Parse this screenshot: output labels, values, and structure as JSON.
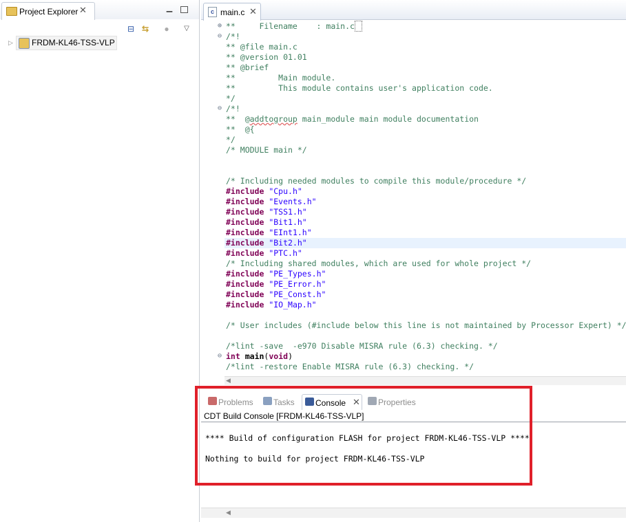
{
  "project_explorer": {
    "tab_label": "Project Explorer",
    "project_name": "FRDM-KL46-TSS-VLP",
    "icons": [
      "folder-icon",
      "close-icon",
      "minimize-icon",
      "maximize-icon",
      "collapse-all-icon",
      "link-with-editor-icon",
      "filter-icon",
      "view-menu-icon",
      "project-icon",
      "expand-arrow-icon"
    ]
  },
  "editor": {
    "tab_label": "main.c",
    "lines": [
      {
        "fold": "⊕",
        "segs": [
          {
            "t": "**     Filename    : main.c",
            "c": "cm"
          },
          {
            "t": " ",
            "c": "caret"
          }
        ]
      },
      {
        "fold": "⊖",
        "segs": [
          {
            "t": "/*!",
            "c": "cm"
          }
        ]
      },
      {
        "segs": [
          {
            "t": "** @file main.c",
            "c": "cm"
          }
        ]
      },
      {
        "segs": [
          {
            "t": "** @version 01.01",
            "c": "cm"
          }
        ]
      },
      {
        "segs": [
          {
            "t": "** @brief",
            "c": "cm"
          }
        ]
      },
      {
        "segs": [
          {
            "t": "**         Main module.",
            "c": "cm"
          }
        ]
      },
      {
        "segs": [
          {
            "t": "**         This module contains user's application code.",
            "c": "cm"
          }
        ]
      },
      {
        "segs": [
          {
            "t": "*/",
            "c": "cm"
          }
        ]
      },
      {
        "fold": "⊖",
        "segs": [
          {
            "t": "/*!",
            "c": "cm"
          }
        ]
      },
      {
        "segs": [
          {
            "t": "**  @",
            "c": "cm"
          },
          {
            "t": "addtogroup",
            "c": "ul"
          },
          {
            "t": " main_module main module documentation",
            "c": "cm"
          }
        ]
      },
      {
        "segs": [
          {
            "t": "**  @{",
            "c": "cm"
          }
        ]
      },
      {
        "segs": [
          {
            "t": "*/",
            "c": "cm"
          }
        ]
      },
      {
        "segs": [
          {
            "t": "/* MODULE main */",
            "c": "cm"
          }
        ]
      },
      {
        "segs": []
      },
      {
        "segs": []
      },
      {
        "segs": [
          {
            "t": "/* Including needed modules to compile this module/procedure */",
            "c": "cm"
          }
        ]
      },
      {
        "segs": [
          {
            "t": "#include",
            "c": "kw"
          },
          {
            "t": " ",
            "c": "cm"
          },
          {
            "t": "\"Cpu.h\"",
            "c": "str"
          }
        ]
      },
      {
        "segs": [
          {
            "t": "#include",
            "c": "kw"
          },
          {
            "t": " ",
            "c": "cm"
          },
          {
            "t": "\"Events.h\"",
            "c": "str"
          }
        ]
      },
      {
        "segs": [
          {
            "t": "#include",
            "c": "kw"
          },
          {
            "t": " ",
            "c": "cm"
          },
          {
            "t": "\"TSS1.h\"",
            "c": "str"
          }
        ]
      },
      {
        "segs": [
          {
            "t": "#include",
            "c": "kw"
          },
          {
            "t": " ",
            "c": "cm"
          },
          {
            "t": "\"Bit1.h\"",
            "c": "str"
          }
        ]
      },
      {
        "segs": [
          {
            "t": "#include",
            "c": "kw"
          },
          {
            "t": " ",
            "c": "cm"
          },
          {
            "t": "\"EInt1.h\"",
            "c": "str"
          }
        ]
      },
      {
        "hl": true,
        "segs": [
          {
            "t": "#include",
            "c": "kw"
          },
          {
            "t": " ",
            "c": "cm"
          },
          {
            "t": "\"Bit2.h\"",
            "c": "str"
          }
        ]
      },
      {
        "segs": [
          {
            "t": "#include",
            "c": "kw"
          },
          {
            "t": " ",
            "c": "cm"
          },
          {
            "t": "\"PTC.h\"",
            "c": "str"
          }
        ]
      },
      {
        "segs": [
          {
            "t": "/* Including shared modules, which are used for whole project */",
            "c": "cm"
          }
        ]
      },
      {
        "segs": [
          {
            "t": "#include",
            "c": "kw"
          },
          {
            "t": " ",
            "c": "cm"
          },
          {
            "t": "\"PE_Types.h\"",
            "c": "str"
          }
        ]
      },
      {
        "segs": [
          {
            "t": "#include",
            "c": "kw"
          },
          {
            "t": " ",
            "c": "cm"
          },
          {
            "t": "\"PE_Error.h\"",
            "c": "str"
          }
        ]
      },
      {
        "segs": [
          {
            "t": "#include",
            "c": "kw"
          },
          {
            "t": " ",
            "c": "cm"
          },
          {
            "t": "\"PE_Const.h\"",
            "c": "str"
          }
        ]
      },
      {
        "segs": [
          {
            "t": "#include",
            "c": "kw"
          },
          {
            "t": " ",
            "c": "cm"
          },
          {
            "t": "\"IO_Map.h\"",
            "c": "str"
          }
        ]
      },
      {
        "segs": []
      },
      {
        "segs": [
          {
            "t": "/* User includes (#include below this line is not maintained by Processor Expert) */",
            "c": "cm"
          }
        ]
      },
      {
        "segs": []
      },
      {
        "segs": [
          {
            "t": "/*lint -save  -e970 Disable MISRA rule (6.3) checking. */",
            "c": "cm"
          }
        ]
      },
      {
        "fold": "⊖",
        "segs": [
          {
            "t": "int",
            "c": "kw"
          },
          {
            "t": " ",
            "c": "cm"
          },
          {
            "t": "main",
            "c": "fn"
          },
          {
            "t": "(",
            "c": "pl"
          },
          {
            "t": "void",
            "c": "kw"
          },
          {
            "t": ")",
            "c": "pl"
          }
        ]
      },
      {
        "segs": [
          {
            "t": "/*lint -restore Enable MISRA rule (6.3) checking. */",
            "c": "cm"
          }
        ]
      }
    ]
  },
  "console": {
    "tabs": [
      {
        "label": "Problems",
        "icon": "problems-icon",
        "color": "#c96a6a"
      },
      {
        "label": "Tasks",
        "icon": "tasks-icon",
        "color": "#8aa0c0"
      },
      {
        "label": "Console",
        "icon": "console-icon",
        "color": "#3a5b99"
      },
      {
        "label": "Properties",
        "icon": "properties-icon",
        "color": "#a0a8b4"
      }
    ],
    "active_tab": "Console",
    "title": "CDT Build Console [FRDM-KL46-TSS-VLP]",
    "lines": [
      "**** Build of configuration FLASH for project FRDM-KL46-TSS-VLP ****",
      "Nothing to build for project FRDM-KL46-TSS-VLP"
    ]
  },
  "colors": {
    "highlight_box": "#e0202a",
    "keyword": "#7f0055",
    "string": "#2a00ff",
    "comment": "#3f7f5f"
  }
}
